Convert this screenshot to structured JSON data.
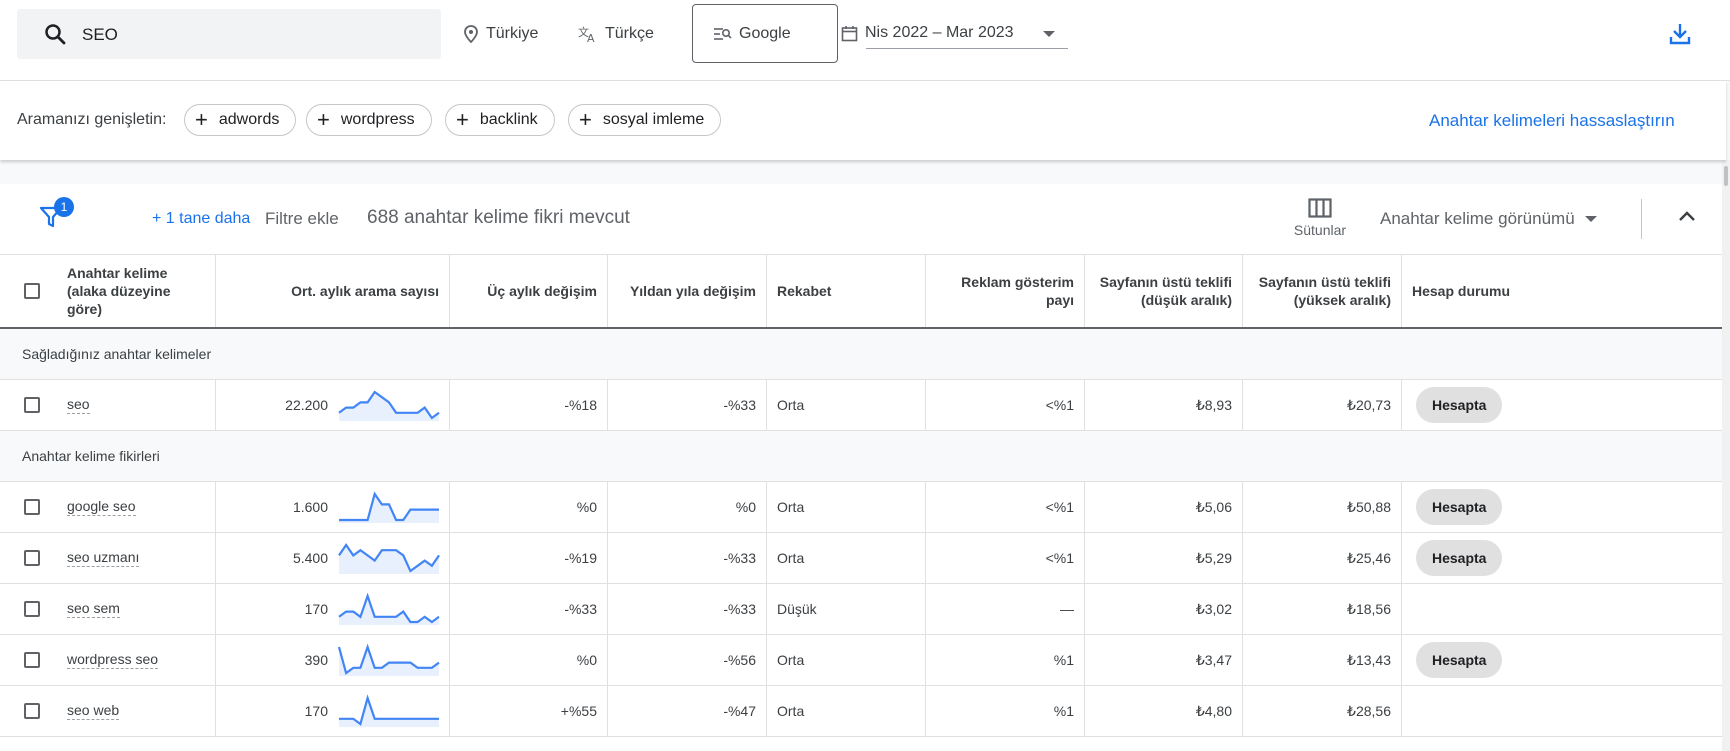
{
  "search": {
    "value": "SEO"
  },
  "location": "Türkiye",
  "language": "Türkçe",
  "engine": "Google",
  "date_range": "Nis 2022 – Mar 2023",
  "expand": {
    "label": "Aramanızı genişletin:",
    "chips": [
      "adwords",
      "wordpress",
      "backlink",
      "sosyal imleme"
    ],
    "refine_link": "Anahtar kelimeleri hassaslaştırın"
  },
  "filterbar": {
    "badge": "1",
    "more_link": "+ 1 tane daha",
    "add_filter": "Filtre ekle",
    "count": "688 anahtar kelime fikri mevcut",
    "columns_label": "Sütunlar",
    "view_label": "Anahtar kelime görünümü"
  },
  "columns": {
    "keyword": "Anahtar kelime (alaka düzeyine göre)",
    "avg_searches": "Ort. aylık arama sayısı",
    "three_month": "Üç aylık değişim",
    "yoy": "Yıldan yıla değişim",
    "competition": "Rekabet",
    "impression_share": "Reklam gösterim payı",
    "bid_low": "Sayfanın üstü teklifi (düşük aralık)",
    "bid_high": "Sayfanın üstü teklifi (yüksek aralık)",
    "account_status": "Hesap durumu"
  },
  "groups": {
    "provided": "Sağladığınız anahtar kelimeler",
    "ideas": "Anahtar kelime fikirleri"
  },
  "provided_rows": [
    {
      "keyword": "seo",
      "avg": "22.200",
      "trend": [
        5,
        4,
        4,
        3,
        3,
        1,
        2,
        3,
        5,
        5,
        5,
        5,
        4,
        6,
        5
      ],
      "three_month": "-%18",
      "yoy": "-%33",
      "competition": "Orta",
      "impression": "<%1",
      "bid_low": "₺8,93",
      "bid_high": "₺20,73",
      "status": "Hesapta"
    }
  ],
  "idea_rows": [
    {
      "keyword": "google seo",
      "avg": "1.600",
      "trend": [
        6,
        6,
        6,
        6,
        6,
        1,
        3,
        3,
        6,
        6,
        4,
        4,
        4,
        4,
        4
      ],
      "three_month": "%0",
      "yoy": "%0",
      "competition": "Orta",
      "impression": "<%1",
      "bid_low": "₺5,06",
      "bid_high": "₺50,88",
      "status": "Hesapta"
    },
    {
      "keyword": "seo uzmanı",
      "avg": "5.400",
      "trend": [
        3,
        1,
        3,
        2,
        3,
        4,
        2,
        2,
        2,
        3,
        6,
        5,
        4,
        5,
        3
      ],
      "three_month": "-%19",
      "yoy": "-%33",
      "competition": "Orta",
      "impression": "<%1",
      "bid_low": "₺5,29",
      "bid_high": "₺25,46",
      "status": "Hesapta"
    },
    {
      "keyword": "seo sem",
      "avg": "170",
      "trend": [
        5,
        4,
        4,
        5,
        1,
        5,
        5,
        5,
        5,
        4,
        6,
        6,
        5,
        6,
        5
      ],
      "three_month": "-%33",
      "yoy": "-%33",
      "competition": "Düşük",
      "impression": "—",
      "bid_low": "₺3,02",
      "bid_high": "₺18,56",
      "status": ""
    },
    {
      "keyword": "wordpress seo",
      "avg": "390",
      "trend": [
        1,
        6,
        5,
        5,
        1,
        5,
        5,
        4,
        4,
        4,
        4,
        5,
        5,
        5,
        4
      ],
      "three_month": "%0",
      "yoy": "-%56",
      "competition": "Orta",
      "impression": "%1",
      "bid_low": "₺3,47",
      "bid_high": "₺13,43",
      "status": "Hesapta"
    },
    {
      "keyword": "seo web",
      "avg": "170",
      "trend": [
        5,
        5,
        5,
        6,
        1,
        5,
        5,
        5,
        5,
        5,
        5,
        5,
        5,
        5,
        5
      ],
      "three_month": "+%55",
      "yoy": "-%47",
      "competition": "Orta",
      "impression": "%1",
      "bid_low": "₺4,80",
      "bid_high": "₺28,56",
      "status": ""
    }
  ],
  "colors": {
    "accent": "#1a73e8",
    "sparkline": "#4285f4",
    "chip_bg": "#e0e0e0"
  }
}
